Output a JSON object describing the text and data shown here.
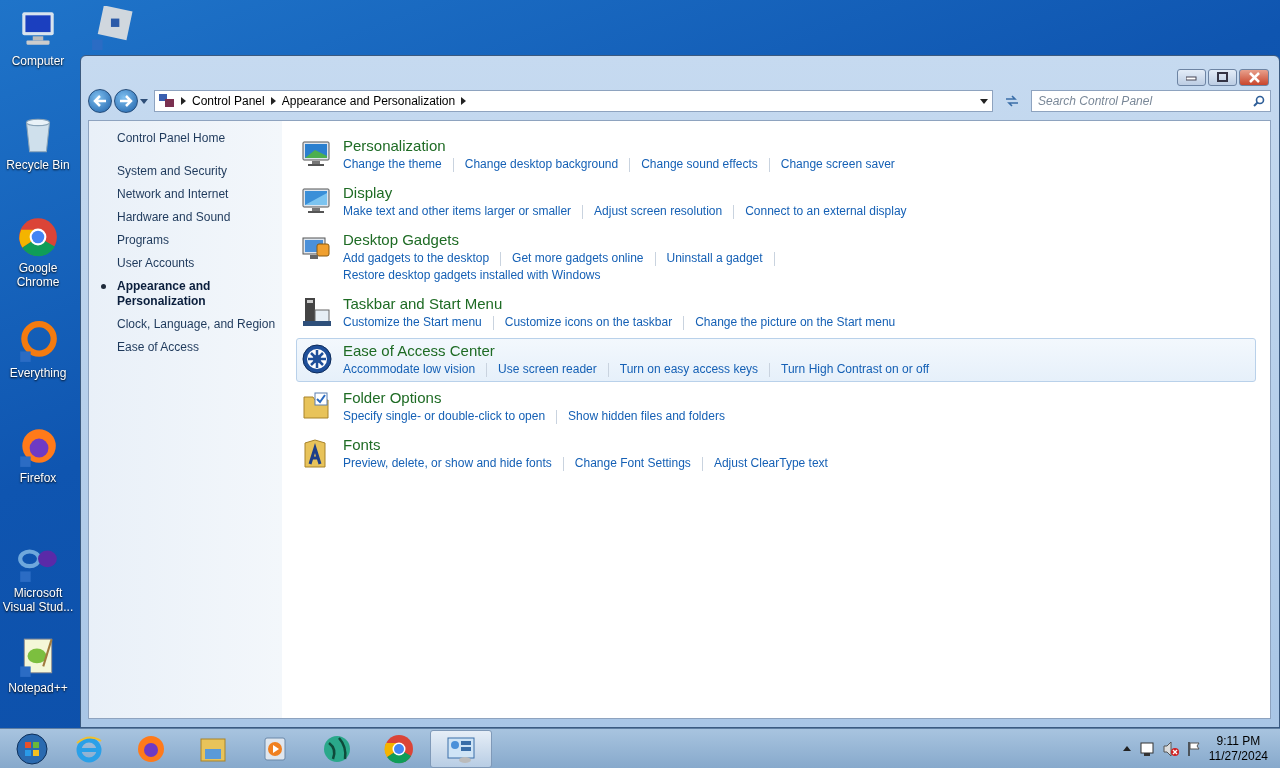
{
  "desktop_icons": [
    {
      "label": "Computer"
    },
    {
      "label": "Recycle Bin"
    },
    {
      "label": "Google Chrome"
    },
    {
      "label": "Everything"
    },
    {
      "label": "Firefox"
    },
    {
      "label": "Microsoft Visual Stud..."
    },
    {
      "label": "Notepad++"
    }
  ],
  "window": {
    "breadcrumb": [
      "Control Panel",
      "Appearance and Personalization"
    ],
    "search": {
      "placeholder": "Search Control Panel"
    }
  },
  "sidebar": {
    "home": "Control Panel Home",
    "items": [
      {
        "label": "System and Security",
        "selected": false
      },
      {
        "label": "Network and Internet",
        "selected": false
      },
      {
        "label": "Hardware and Sound",
        "selected": false
      },
      {
        "label": "Programs",
        "selected": false
      },
      {
        "label": "User Accounts",
        "selected": false
      },
      {
        "label": "Appearance and Personalization",
        "selected": true
      },
      {
        "label": "Clock, Language, and Region",
        "selected": false
      },
      {
        "label": "Ease of Access",
        "selected": false
      }
    ]
  },
  "categories": [
    {
      "title": "Personalization",
      "hovered": false,
      "rows": [
        [
          "Change the theme",
          "Change desktop background",
          "Change sound effects",
          "Change screen saver"
        ]
      ]
    },
    {
      "title": "Display",
      "hovered": false,
      "rows": [
        [
          "Make text and other items larger or smaller",
          "Adjust screen resolution",
          "Connect to an external display"
        ]
      ]
    },
    {
      "title": "Desktop Gadgets",
      "hovered": false,
      "rows": [
        [
          "Add gadgets to the desktop",
          "Get more gadgets online",
          "Uninstall a gadget",
          ""
        ],
        [
          "Restore desktop gadgets installed with Windows"
        ]
      ]
    },
    {
      "title": "Taskbar and Start Menu",
      "hovered": false,
      "rows": [
        [
          "Customize the Start menu",
          "Customize icons on the taskbar",
          "Change the picture on the Start menu"
        ]
      ]
    },
    {
      "title": "Ease of Access Center",
      "hovered": true,
      "rows": [
        [
          "Accommodate low vision",
          "Use screen reader",
          "Turn on easy access keys",
          "Turn High Contrast on or off"
        ]
      ]
    },
    {
      "title": "Folder Options",
      "hovered": false,
      "rows": [
        [
          "Specify single- or double-click to open",
          "Show hidden files and folders"
        ]
      ]
    },
    {
      "title": "Fonts",
      "hovered": false,
      "rows": [
        [
          "Preview, delete, or show and hide fonts",
          "Change Font Settings",
          "Adjust ClearType text"
        ]
      ]
    }
  ],
  "taskbar": {
    "time": "9:11 PM",
    "date": "11/27/2024"
  }
}
